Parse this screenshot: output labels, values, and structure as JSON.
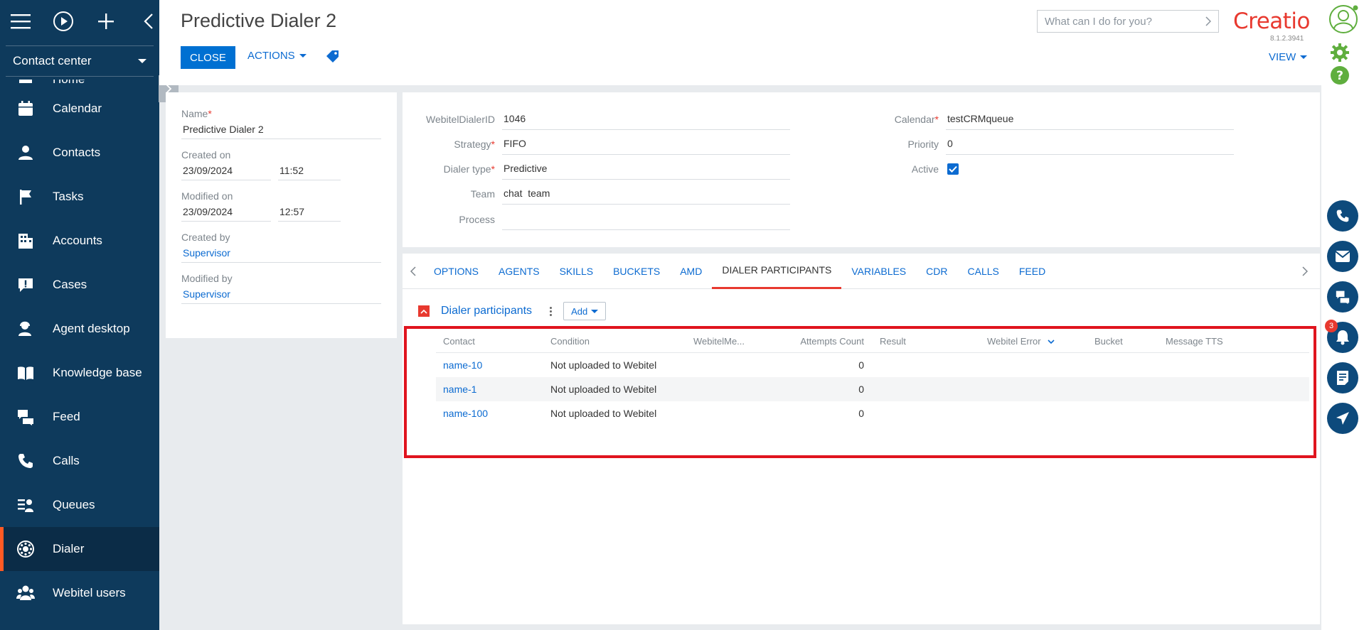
{
  "app": {
    "workspace": "Contact center",
    "logo": "Creatio",
    "version": "8.1.2.3941",
    "search_placeholder": "What can I do for you?",
    "notification_count": "3"
  },
  "nav": {
    "items": [
      {
        "label": "Home",
        "icon": "home-icon"
      },
      {
        "label": "Calendar",
        "icon": "calendar-icon"
      },
      {
        "label": "Contacts",
        "icon": "person-icon"
      },
      {
        "label": "Tasks",
        "icon": "flag-icon"
      },
      {
        "label": "Accounts",
        "icon": "building-icon"
      },
      {
        "label": "Cases",
        "icon": "exclamation-bubble-icon"
      },
      {
        "label": "Agent desktop",
        "icon": "agent-icon"
      },
      {
        "label": "Knowledge base",
        "icon": "book-icon"
      },
      {
        "label": "Feed",
        "icon": "chat-bubbles-icon"
      },
      {
        "label": "Calls",
        "icon": "phone-icon"
      },
      {
        "label": "Queues",
        "icon": "queue-icon"
      },
      {
        "label": "Dialer",
        "icon": "dialer-icon"
      },
      {
        "label": "Webitel users",
        "icon": "users-icon"
      }
    ],
    "active": "Dialer"
  },
  "header": {
    "title": "Predictive Dialer 2",
    "close_label": "CLOSE",
    "actions_label": "ACTIONS",
    "view_label": "VIEW"
  },
  "info": {
    "name_label": "Name",
    "name_value": "Predictive Dialer 2",
    "created_on_label": "Created on",
    "created_date": "23/09/2024",
    "created_time": "11:52",
    "modified_on_label": "Modified on",
    "modified_date": "23/09/2024",
    "modified_time": "12:57",
    "created_by_label": "Created by",
    "created_by": "Supervisor",
    "modified_by_label": "Modified by",
    "modified_by": "Supervisor"
  },
  "details": {
    "dialer_id_label": "WebitelDialerID",
    "dialer_id": "1046",
    "strategy_label": "Strategy",
    "strategy": "FIFO",
    "type_label": "Dialer type",
    "type": "Predictive",
    "team_label": "Team",
    "team": "chat  team",
    "process_label": "Process",
    "process": "",
    "calendar_label": "Calendar",
    "calendar": "testCRMqueue",
    "priority_label": "Priority",
    "priority": "0",
    "active_label": "Active",
    "active": true
  },
  "tabs": [
    "OPTIONS",
    "AGENTS",
    "SKILLS",
    "BUCKETS",
    "AMD",
    "DIALER PARTICIPANTS",
    "VARIABLES",
    "CDR",
    "CALLS",
    "FEED"
  ],
  "active_tab": "DIALER PARTICIPANTS",
  "participants": {
    "title": "Dialer participants",
    "add_label": "Add",
    "columns": [
      "Contact",
      "Condition",
      "WebitelMe...",
      "Attempts Count",
      "Result",
      "Webitel Error",
      "Bucket",
      "Message TTS"
    ],
    "rows": [
      {
        "contact": "name-10",
        "condition": "Not uploaded to Webitel",
        "webitel_me": "",
        "attempts": "0",
        "result": "",
        "error": "",
        "bucket": "",
        "tts": ""
      },
      {
        "contact": "name-1",
        "condition": "Not uploaded to Webitel",
        "webitel_me": "",
        "attempts": "0",
        "result": "",
        "error": "",
        "bucket": "",
        "tts": ""
      },
      {
        "contact": "name-100",
        "condition": "Not uploaded to Webitel",
        "webitel_me": "",
        "attempts": "0",
        "result": "",
        "error": "",
        "bucket": "",
        "tts": ""
      }
    ]
  }
}
